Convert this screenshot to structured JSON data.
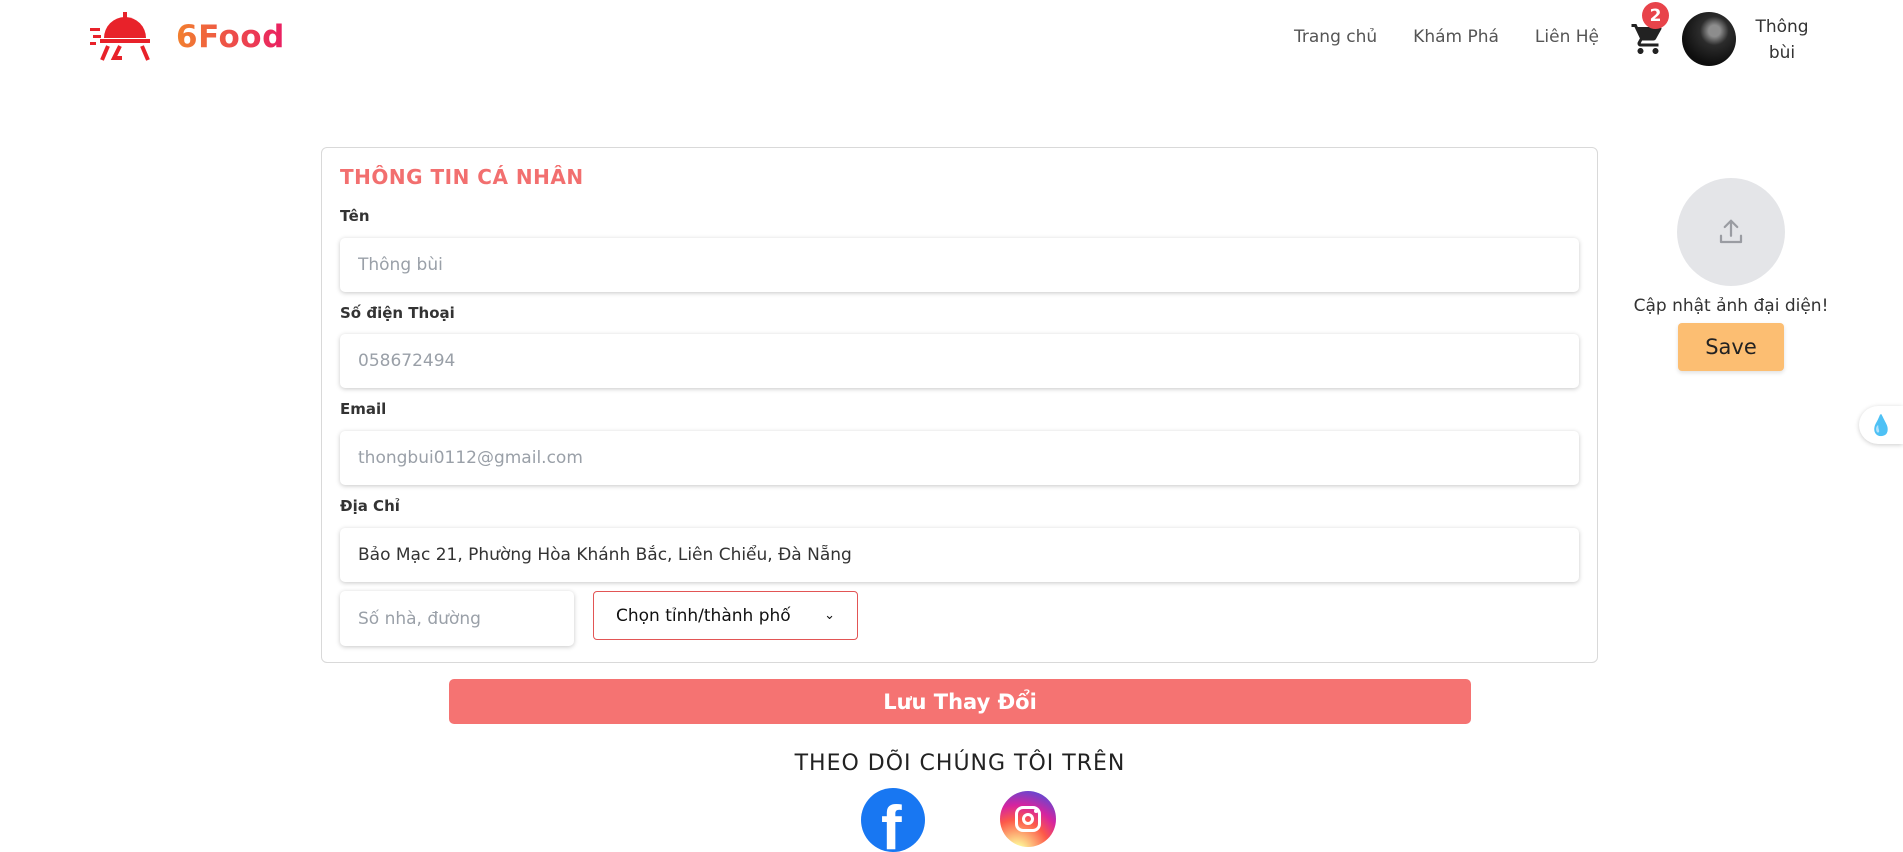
{
  "header": {
    "logo_text": "6Food",
    "nav": [
      "Trang chủ",
      "Khám Phá",
      "Liên Hệ"
    ],
    "cart_count": "2",
    "user_name": "Thông bùi"
  },
  "profile": {
    "title": "THÔNG TIN CÁ NHÂN",
    "name_label": "Tên",
    "name_placeholder": "Thông bùi",
    "phone_label": "Số điện Thoại",
    "phone_placeholder": "058672494",
    "email_label": "Email",
    "email_placeholder": "thongbui0112@gmail.com",
    "address_label": "Địa Chỉ",
    "address_value": "Bảo Mạc 21, Phường Hòa Khánh Bắc, Liên Chiểu, Đà Nẵng",
    "street_placeholder": "Số nhà, đường",
    "city_select": "Chọn tỉnh/thành phố",
    "save_changes": "Lưu Thay Đổi"
  },
  "avatar_panel": {
    "update_text": "Cập nhật ảnh đại diện!",
    "save_label": "Save"
  },
  "footer": {
    "follow_title": "THEO DÕI CHÚNG TÔI TRÊN"
  },
  "colors": {
    "accent": "#f57372",
    "title": "#f26f6f",
    "save": "#fcbe72",
    "badge": "#e8434a"
  }
}
